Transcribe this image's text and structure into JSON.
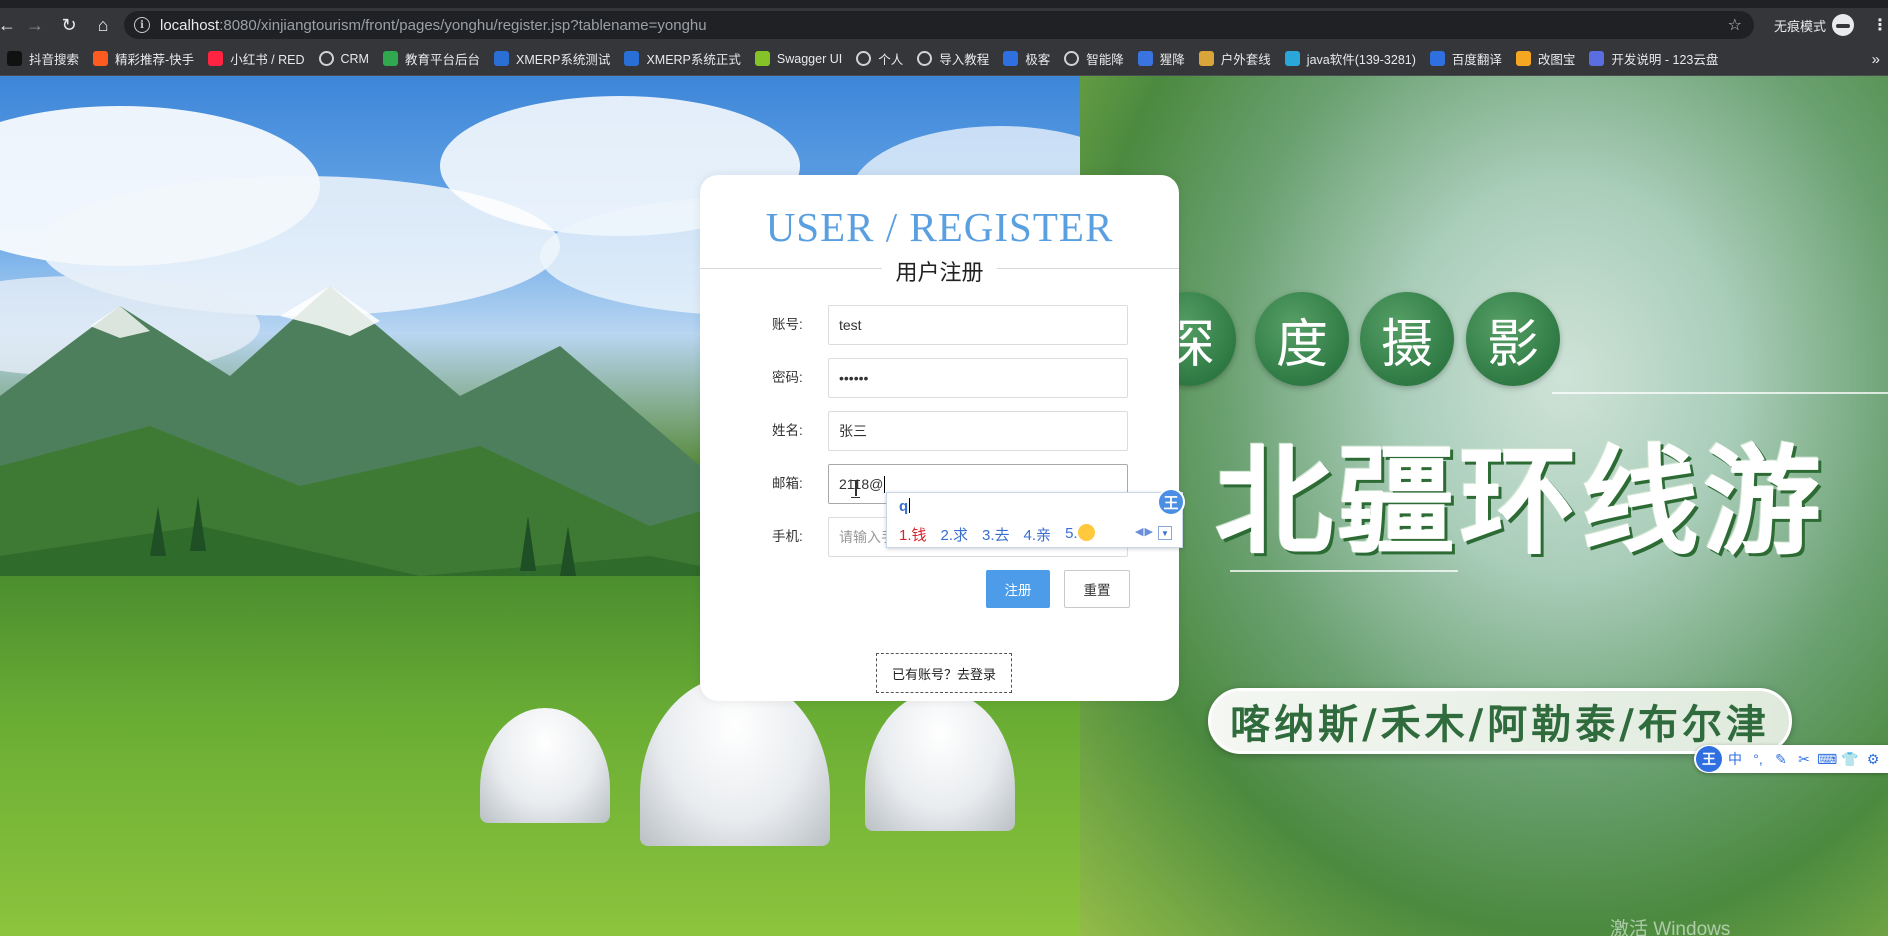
{
  "browser": {
    "url_host": "localhost",
    "url_rest": ":8080/xinjiangtourism/front/pages/yonghu/register.jsp?tablename=yonghu",
    "incognito_label": "无痕模式"
  },
  "bookmarks": [
    {
      "label": "抖音搜索",
      "icon": "douyin-icon",
      "color": "#111111"
    },
    {
      "label": "精彩推荐-快手",
      "icon": "kuaishou-icon",
      "color": "#ff5a1f"
    },
    {
      "label": "小红书 / RED",
      "icon": "xiaohongshu-icon",
      "color": "#ff2442"
    },
    {
      "label": "CRM",
      "icon": "globe-icon",
      "color": ""
    },
    {
      "label": "教育平台后台",
      "icon": "edu-icon",
      "color": "#2fa84f"
    },
    {
      "label": "XMERP系统测试",
      "icon": "xmerp-icon",
      "color": "#2a6fd6"
    },
    {
      "label": "XMERP系统正式",
      "icon": "xmerp-icon",
      "color": "#2a6fd6"
    },
    {
      "label": "Swagger UI",
      "icon": "swagger-icon",
      "color": "#85c227"
    },
    {
      "label": "个人",
      "icon": "globe-icon",
      "color": ""
    },
    {
      "label": "导入教程",
      "icon": "globe-icon",
      "color": ""
    },
    {
      "label": "极客",
      "icon": "geek-icon",
      "color": "#2f6fe0"
    },
    {
      "label": "智能降",
      "icon": "globe-icon",
      "color": ""
    },
    {
      "label": "猩降",
      "icon": "shield-icon",
      "color": "#3a74e0"
    },
    {
      "label": "户外套线",
      "icon": "outdoor-icon",
      "color": "#d9a53a"
    },
    {
      "label": "java软件(139-3281)",
      "icon": "tv-icon",
      "color": "#2aa6d8"
    },
    {
      "label": "百度翻译",
      "icon": "baidu-translate-icon",
      "color": "#2f6fe0"
    },
    {
      "label": "改图宝",
      "icon": "gaitubao-icon",
      "color": "#f5a623"
    },
    {
      "label": "开发说明 - 123云盘",
      "icon": "cloud-drive-icon",
      "color": "#5b6ee1"
    }
  ],
  "poster": {
    "tags": [
      "深",
      "度",
      "摄",
      "影"
    ],
    "title": "北疆环线游",
    "subtitle": "喀纳斯/禾木/阿勒泰/布尔津",
    "watermark": "激活 Windows"
  },
  "form": {
    "title": "USER / REGISTER",
    "subtitle": "用户注册",
    "fields": [
      {
        "label": "账号:",
        "value": "test",
        "placeholder": ""
      },
      {
        "label": "密码:",
        "value": "••••••",
        "placeholder": ""
      },
      {
        "label": "姓名:",
        "value": "张三",
        "placeholder": ""
      },
      {
        "label": "邮箱:",
        "value": "2118@",
        "placeholder": ""
      },
      {
        "label": "手机:",
        "value": "",
        "placeholder": "请输入手机"
      }
    ],
    "register_label": "注册",
    "reset_label": "重置",
    "login_link": "已有账号？去登录"
  },
  "ime": {
    "logo": "王",
    "pinyin": "q",
    "candidates": [
      "1.钱",
      "2.求",
      "3.去",
      "4.亲",
      "5."
    ],
    "toolbar": [
      "中",
      "°,",
      "✎",
      "✂",
      "⌨",
      "👕",
      "⚙"
    ]
  },
  "colors": {
    "accent": "#4d9cea",
    "title_blue": "#5a9fe0",
    "poster_green": "#2f7a44"
  }
}
